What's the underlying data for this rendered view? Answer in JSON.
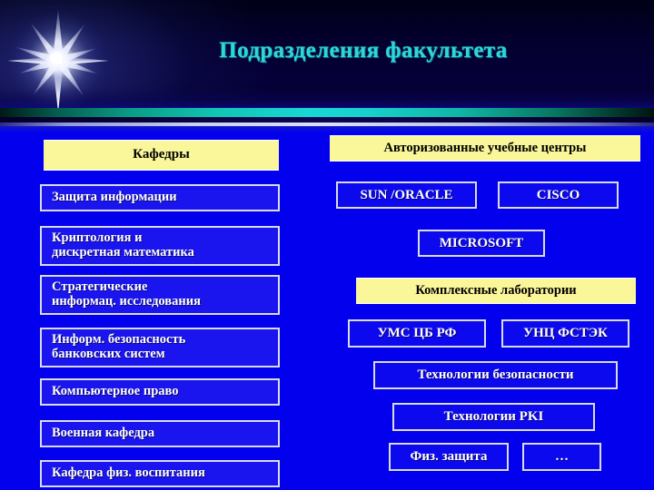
{
  "slide": {
    "title": "Подразделения факультета",
    "colors": {
      "background": "#0300EE",
      "banner": "#03002e",
      "title_text": "#2fd6d6",
      "header_box_fill": "#FAF79A",
      "header_box_text": "#000000",
      "item_box_fill": "#1A14EE",
      "item_box_border": "#d8dce8",
      "item_box_text": "#FFFFFF",
      "rule_teal": "#18d8d4"
    },
    "decoration": {
      "starburst": "starburst-icon"
    }
  },
  "left_column": {
    "header": "Кафедры",
    "items": [
      {
        "label": "Защита информации"
      },
      {
        "label": "Криптология и\nдискретная математика"
      },
      {
        "label": "Стратегические\nинформац. исследования"
      },
      {
        "label": "Информ. безопасность\nбанковских систем"
      },
      {
        "label": "Компьютерное право"
      },
      {
        "label": "Военная кафедра"
      },
      {
        "label": "Кафедра физ. воспитания"
      }
    ]
  },
  "right_column": {
    "section_one": {
      "header": "Авторизованные учебные центры",
      "items": [
        {
          "label": "SUN /ORACLE"
        },
        {
          "label": "CISCO"
        },
        {
          "label": "MICROSOFT"
        }
      ]
    },
    "section_two": {
      "header": "Комплексные лаборатории",
      "items": [
        {
          "label": "УМС ЦБ РФ"
        },
        {
          "label": "УНЦ ФСТЭК"
        },
        {
          "label": "Технологии безопасности"
        },
        {
          "label": "Технологии PKI"
        },
        {
          "label": "Физ. защита"
        },
        {
          "label": "…"
        }
      ]
    }
  }
}
